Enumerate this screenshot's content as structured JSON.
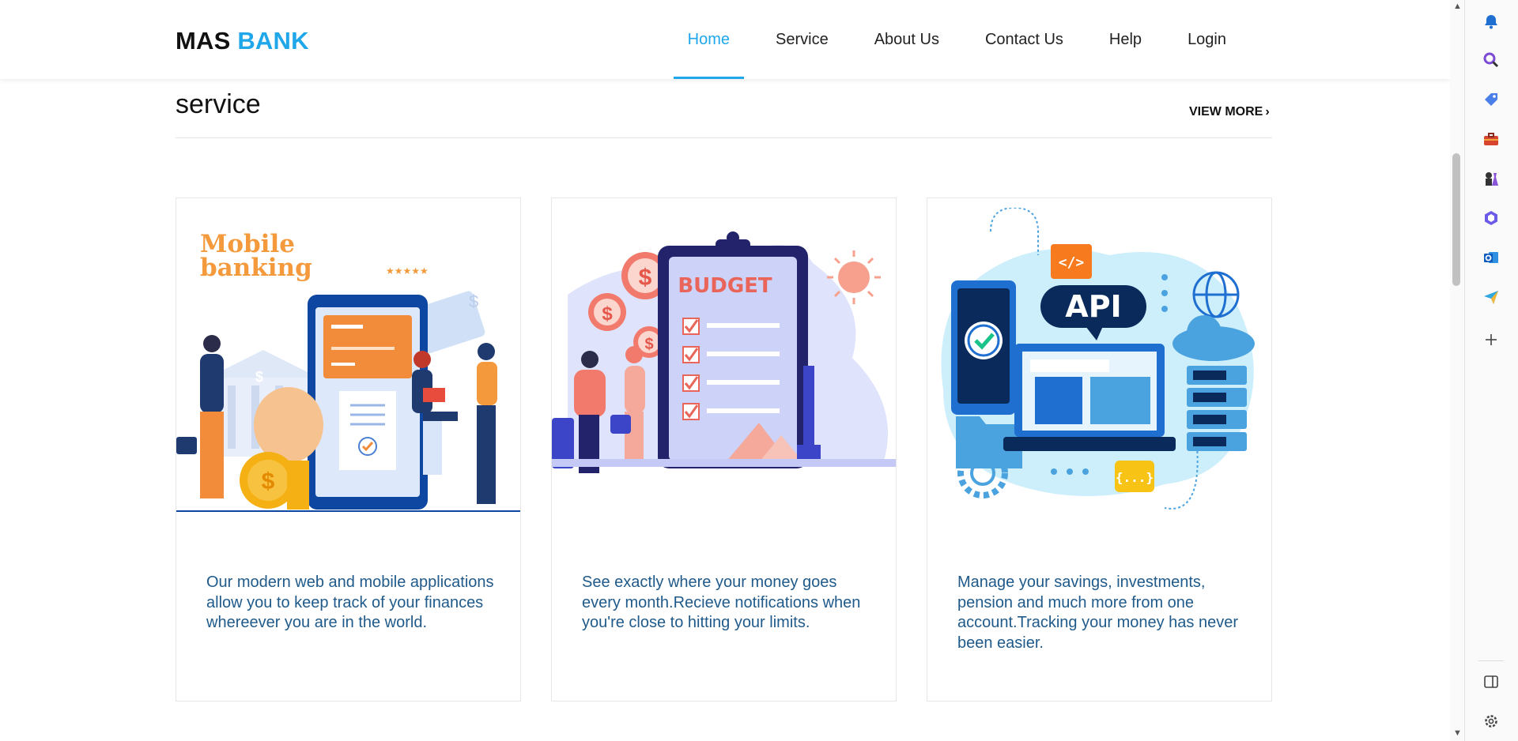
{
  "header": {
    "logo_part1": "MAS",
    "logo_part2": "BANK",
    "nav": [
      {
        "label": "Home",
        "active": true
      },
      {
        "label": "Service",
        "active": false
      },
      {
        "label": "About Us",
        "active": false
      },
      {
        "label": "Contact Us",
        "active": false
      },
      {
        "label": "Help",
        "active": false
      },
      {
        "label": "Login",
        "active": false
      }
    ]
  },
  "section": {
    "title": "service",
    "view_more": "VIEW MORE"
  },
  "cards": [
    {
      "illustration_text_1": "Mobile",
      "illustration_text_2": "banking",
      "description": "Our modern web and mobile applications allow you to keep track of your finances whereever you are in the world."
    },
    {
      "illustration_text_1": "BUDGET",
      "description": "See exactly where your money goes every month.Recieve notifications when you're close to hitting your limits."
    },
    {
      "illustration_text_1": "API",
      "illustration_text_2": "</>",
      "illustration_text_3": "{...}",
      "description": "Manage your savings, investments, pension and much more from one account.Tracking your money has never been easier."
    }
  ],
  "sidebar_icons": [
    "bell-icon",
    "search-icon",
    "tag-icon",
    "toolbox-icon",
    "games-icon",
    "copilot-icon",
    "outlook-icon",
    "send-icon",
    "add-icon",
    "split-view-icon",
    "settings-icon"
  ],
  "colors": {
    "accent": "#1fa7ea",
    "description_text": "#1f5a8a"
  }
}
